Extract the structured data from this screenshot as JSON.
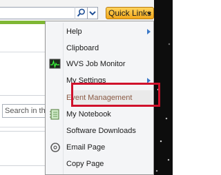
{
  "toolbar": {
    "quick_links_label": "Quick Links"
  },
  "left_panel": {
    "search_placeholder": "Search in th"
  },
  "menu": {
    "items": [
      {
        "label": "Help",
        "icon": "none",
        "submenu": true
      },
      {
        "label": "Clipboard",
        "icon": "none",
        "submenu": false
      },
      {
        "label": "WVS Job Monitor",
        "icon": "heartbeat-monitor-icon",
        "submenu": false
      },
      {
        "label": "My Settings",
        "icon": "none",
        "submenu": true
      },
      {
        "label": "Event Management",
        "icon": "none",
        "submenu": false,
        "highlighted": true
      },
      {
        "label": "My Notebook",
        "icon": "notebook-icon",
        "submenu": false
      },
      {
        "label": "Software Downloads",
        "icon": "none",
        "submenu": false
      },
      {
        "label": "Email Page",
        "icon": "email-icon",
        "submenu": false
      },
      {
        "label": "Copy Page",
        "icon": "none",
        "submenu": false
      }
    ]
  },
  "colors": {
    "quick_links_bg": "#f2a81c",
    "highlight_border": "#d0112b",
    "accent_band": "#7fb734",
    "submenu_arrow": "#3b78c7",
    "selected_text": "#8a5a44"
  }
}
